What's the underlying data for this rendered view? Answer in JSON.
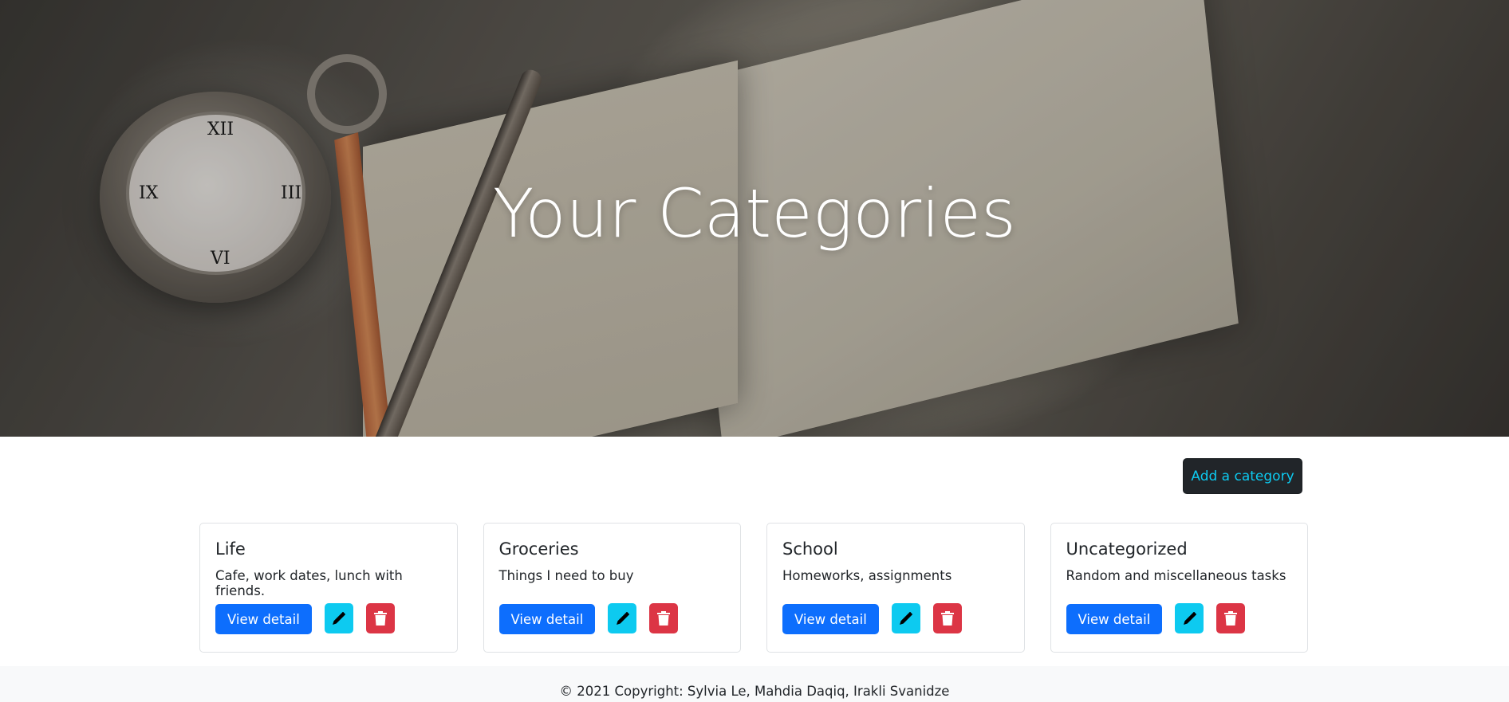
{
  "hero": {
    "title": "Your Categories",
    "image_description": "vintage pocket watch, open notebook and fountain pen"
  },
  "actions": {
    "add_category_label": "Add a category"
  },
  "categories": [
    {
      "name": "Life",
      "description": "Cafe, work dates, lunch with friends.",
      "view_label": "View detail"
    },
    {
      "name": "Groceries",
      "description": "Things I need to buy",
      "view_label": "View detail"
    },
    {
      "name": "School",
      "description": "Homeworks, assignments",
      "view_label": "View detail"
    },
    {
      "name": "Uncategorized",
      "description": "Random and miscellaneous tasks",
      "view_label": "View detail"
    }
  ],
  "icons": {
    "edit": "pencil-icon",
    "delete": "trash-icon"
  },
  "colors": {
    "primary": "#0d6efd",
    "info": "#0dcaf0",
    "danger": "#dc3545",
    "dark": "#212529",
    "footer_bg": "#f8f9fa"
  },
  "footer": {
    "copyright": "© 2021 Copyright: Sylvia Le, Mahdia Daqiq, Irakli Svanidze"
  }
}
